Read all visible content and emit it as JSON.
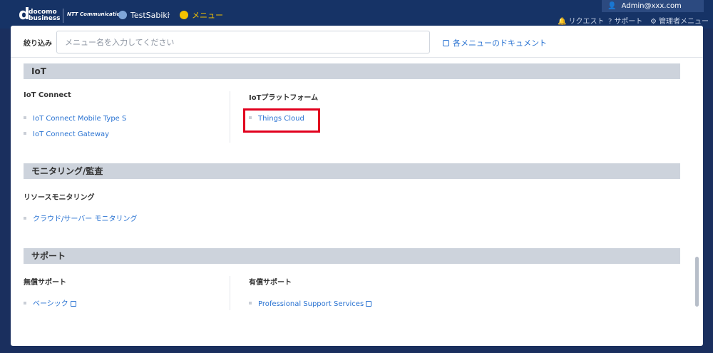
{
  "brand": {
    "mark": "d",
    "line1": "docomo",
    "line2": "business",
    "partner": "NTT Communications"
  },
  "breadcrumb": [
    {
      "label": "TestSabiki"
    },
    {
      "label": "メニュー"
    }
  ],
  "user": {
    "name": "Admin@xxx.com"
  },
  "topnav": {
    "request": "リクエスト",
    "support": "サポート",
    "admin": "管理者メニュー"
  },
  "filter": {
    "label": "絞り込み",
    "placeholder": "メニュー名を入力してください",
    "doc_link": "各メニューのドキュメント"
  },
  "sections": [
    {
      "title": "IoT",
      "groups": [
        {
          "title": "IoT Connect",
          "items": [
            "IoT Connect Mobile Type S",
            "IoT Connect Gateway"
          ]
        },
        {
          "title": "IoTプラットフォーム",
          "items": [
            "Things Cloud"
          ]
        }
      ]
    },
    {
      "title": "モニタリング/監査",
      "groups": [
        {
          "title": "リソースモニタリング",
          "items": [
            "クラウド/サーバー モニタリング"
          ]
        }
      ]
    },
    {
      "title": "サポート",
      "groups": [
        {
          "title": "無償サポート",
          "items": [
            "ベーシック"
          ]
        },
        {
          "title": "有償サポート",
          "items": [
            "Professional Support Services"
          ]
        }
      ]
    }
  ],
  "colors": {
    "navbar": "#163366",
    "link": "#2a73d2",
    "highlight": "#e1001e",
    "active_crumb": "#f3c200"
  }
}
